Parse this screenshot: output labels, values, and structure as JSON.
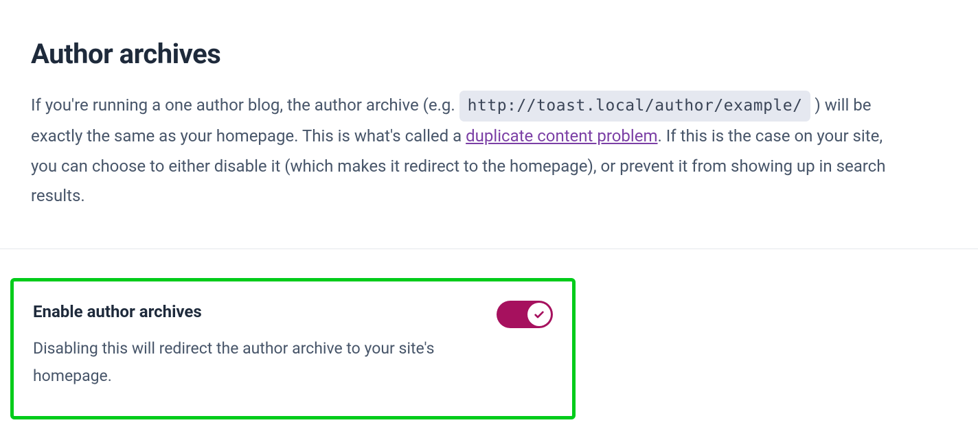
{
  "heading": "Author archives",
  "description": {
    "part1": "If you're running a one author blog, the author archive (e.g. ",
    "code": "http://toast.local/author/example/",
    "part2": ") will be exactly the same as your homepage. This is what's called a ",
    "link_text": "duplicate content problem",
    "part3": ". If this is the case on your site, you can choose to either disable it (which makes it redirect to the homepage), or prevent it from showing up in search results."
  },
  "setting": {
    "title": "Enable author archives",
    "description": "Disabling this will redirect the author archive to your site's homepage.",
    "enabled": true
  },
  "colors": {
    "toggle_active": "#a6115e",
    "highlight_border": "#00cc1a",
    "link": "#7b3fa5"
  }
}
